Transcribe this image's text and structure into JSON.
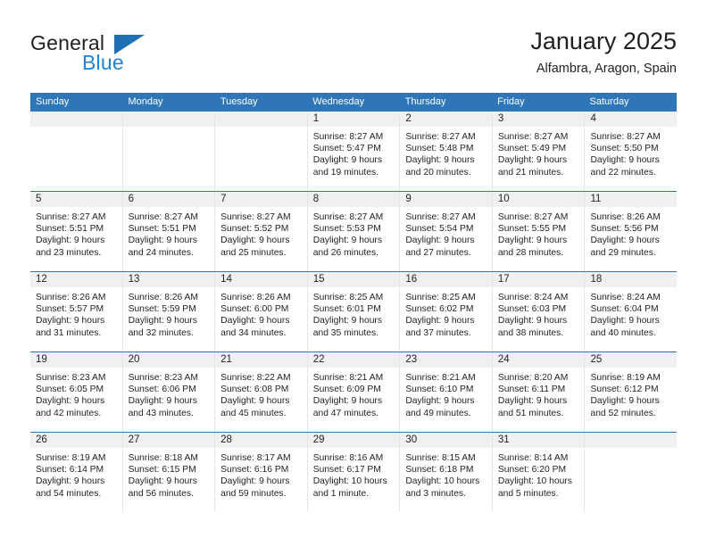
{
  "brand": {
    "name_part1": "General",
    "name_part2": "Blue",
    "triangle_color": "#1f6fb5",
    "blue_color": "#2083d4"
  },
  "header": {
    "title": "January 2025",
    "subtitle": "Alfambra, Aragon, Spain"
  },
  "theme": {
    "header_blue": "#2e76b8",
    "day_strip_gray": "#f0f0f0",
    "text_color": "#231f20"
  },
  "weekday_headers": [
    "Sunday",
    "Monday",
    "Tuesday",
    "Wednesday",
    "Thursday",
    "Friday",
    "Saturday"
  ],
  "weeks": [
    [
      {
        "day": "",
        "sunrise": "",
        "sunset": "",
        "daylight1": "",
        "daylight2": ""
      },
      {
        "day": "",
        "sunrise": "",
        "sunset": "",
        "daylight1": "",
        "daylight2": ""
      },
      {
        "day": "",
        "sunrise": "",
        "sunset": "",
        "daylight1": "",
        "daylight2": ""
      },
      {
        "day": "1",
        "sunrise": "Sunrise: 8:27 AM",
        "sunset": "Sunset: 5:47 PM",
        "daylight1": "Daylight: 9 hours",
        "daylight2": "and 19 minutes."
      },
      {
        "day": "2",
        "sunrise": "Sunrise: 8:27 AM",
        "sunset": "Sunset: 5:48 PM",
        "daylight1": "Daylight: 9 hours",
        "daylight2": "and 20 minutes."
      },
      {
        "day": "3",
        "sunrise": "Sunrise: 8:27 AM",
        "sunset": "Sunset: 5:49 PM",
        "daylight1": "Daylight: 9 hours",
        "daylight2": "and 21 minutes."
      },
      {
        "day": "4",
        "sunrise": "Sunrise: 8:27 AM",
        "sunset": "Sunset: 5:50 PM",
        "daylight1": "Daylight: 9 hours",
        "daylight2": "and 22 minutes."
      }
    ],
    [
      {
        "day": "5",
        "sunrise": "Sunrise: 8:27 AM",
        "sunset": "Sunset: 5:51 PM",
        "daylight1": "Daylight: 9 hours",
        "daylight2": "and 23 minutes."
      },
      {
        "day": "6",
        "sunrise": "Sunrise: 8:27 AM",
        "sunset": "Sunset: 5:51 PM",
        "daylight1": "Daylight: 9 hours",
        "daylight2": "and 24 minutes."
      },
      {
        "day": "7",
        "sunrise": "Sunrise: 8:27 AM",
        "sunset": "Sunset: 5:52 PM",
        "daylight1": "Daylight: 9 hours",
        "daylight2": "and 25 minutes."
      },
      {
        "day": "8",
        "sunrise": "Sunrise: 8:27 AM",
        "sunset": "Sunset: 5:53 PM",
        "daylight1": "Daylight: 9 hours",
        "daylight2": "and 26 minutes."
      },
      {
        "day": "9",
        "sunrise": "Sunrise: 8:27 AM",
        "sunset": "Sunset: 5:54 PM",
        "daylight1": "Daylight: 9 hours",
        "daylight2": "and 27 minutes."
      },
      {
        "day": "10",
        "sunrise": "Sunrise: 8:27 AM",
        "sunset": "Sunset: 5:55 PM",
        "daylight1": "Daylight: 9 hours",
        "daylight2": "and 28 minutes."
      },
      {
        "day": "11",
        "sunrise": "Sunrise: 8:26 AM",
        "sunset": "Sunset: 5:56 PM",
        "daylight1": "Daylight: 9 hours",
        "daylight2": "and 29 minutes."
      }
    ],
    [
      {
        "day": "12",
        "sunrise": "Sunrise: 8:26 AM",
        "sunset": "Sunset: 5:57 PM",
        "daylight1": "Daylight: 9 hours",
        "daylight2": "and 31 minutes."
      },
      {
        "day": "13",
        "sunrise": "Sunrise: 8:26 AM",
        "sunset": "Sunset: 5:59 PM",
        "daylight1": "Daylight: 9 hours",
        "daylight2": "and 32 minutes."
      },
      {
        "day": "14",
        "sunrise": "Sunrise: 8:26 AM",
        "sunset": "Sunset: 6:00 PM",
        "daylight1": "Daylight: 9 hours",
        "daylight2": "and 34 minutes."
      },
      {
        "day": "15",
        "sunrise": "Sunrise: 8:25 AM",
        "sunset": "Sunset: 6:01 PM",
        "daylight1": "Daylight: 9 hours",
        "daylight2": "and 35 minutes."
      },
      {
        "day": "16",
        "sunrise": "Sunrise: 8:25 AM",
        "sunset": "Sunset: 6:02 PM",
        "daylight1": "Daylight: 9 hours",
        "daylight2": "and 37 minutes."
      },
      {
        "day": "17",
        "sunrise": "Sunrise: 8:24 AM",
        "sunset": "Sunset: 6:03 PM",
        "daylight1": "Daylight: 9 hours",
        "daylight2": "and 38 minutes."
      },
      {
        "day": "18",
        "sunrise": "Sunrise: 8:24 AM",
        "sunset": "Sunset: 6:04 PM",
        "daylight1": "Daylight: 9 hours",
        "daylight2": "and 40 minutes."
      }
    ],
    [
      {
        "day": "19",
        "sunrise": "Sunrise: 8:23 AM",
        "sunset": "Sunset: 6:05 PM",
        "daylight1": "Daylight: 9 hours",
        "daylight2": "and 42 minutes."
      },
      {
        "day": "20",
        "sunrise": "Sunrise: 8:23 AM",
        "sunset": "Sunset: 6:06 PM",
        "daylight1": "Daylight: 9 hours",
        "daylight2": "and 43 minutes."
      },
      {
        "day": "21",
        "sunrise": "Sunrise: 8:22 AM",
        "sunset": "Sunset: 6:08 PM",
        "daylight1": "Daylight: 9 hours",
        "daylight2": "and 45 minutes."
      },
      {
        "day": "22",
        "sunrise": "Sunrise: 8:21 AM",
        "sunset": "Sunset: 6:09 PM",
        "daylight1": "Daylight: 9 hours",
        "daylight2": "and 47 minutes."
      },
      {
        "day": "23",
        "sunrise": "Sunrise: 8:21 AM",
        "sunset": "Sunset: 6:10 PM",
        "daylight1": "Daylight: 9 hours",
        "daylight2": "and 49 minutes."
      },
      {
        "day": "24",
        "sunrise": "Sunrise: 8:20 AM",
        "sunset": "Sunset: 6:11 PM",
        "daylight1": "Daylight: 9 hours",
        "daylight2": "and 51 minutes."
      },
      {
        "day": "25",
        "sunrise": "Sunrise: 8:19 AM",
        "sunset": "Sunset: 6:12 PM",
        "daylight1": "Daylight: 9 hours",
        "daylight2": "and 52 minutes."
      }
    ],
    [
      {
        "day": "26",
        "sunrise": "Sunrise: 8:19 AM",
        "sunset": "Sunset: 6:14 PM",
        "daylight1": "Daylight: 9 hours",
        "daylight2": "and 54 minutes."
      },
      {
        "day": "27",
        "sunrise": "Sunrise: 8:18 AM",
        "sunset": "Sunset: 6:15 PM",
        "daylight1": "Daylight: 9 hours",
        "daylight2": "and 56 minutes."
      },
      {
        "day": "28",
        "sunrise": "Sunrise: 8:17 AM",
        "sunset": "Sunset: 6:16 PM",
        "daylight1": "Daylight: 9 hours",
        "daylight2": "and 59 minutes."
      },
      {
        "day": "29",
        "sunrise": "Sunrise: 8:16 AM",
        "sunset": "Sunset: 6:17 PM",
        "daylight1": "Daylight: 10 hours",
        "daylight2": "and 1 minute."
      },
      {
        "day": "30",
        "sunrise": "Sunrise: 8:15 AM",
        "sunset": "Sunset: 6:18 PM",
        "daylight1": "Daylight: 10 hours",
        "daylight2": "and 3 minutes."
      },
      {
        "day": "31",
        "sunrise": "Sunrise: 8:14 AM",
        "sunset": "Sunset: 6:20 PM",
        "daylight1": "Daylight: 10 hours",
        "daylight2": "and 5 minutes."
      },
      {
        "day": "",
        "sunrise": "",
        "sunset": "",
        "daylight1": "",
        "daylight2": ""
      }
    ]
  ]
}
